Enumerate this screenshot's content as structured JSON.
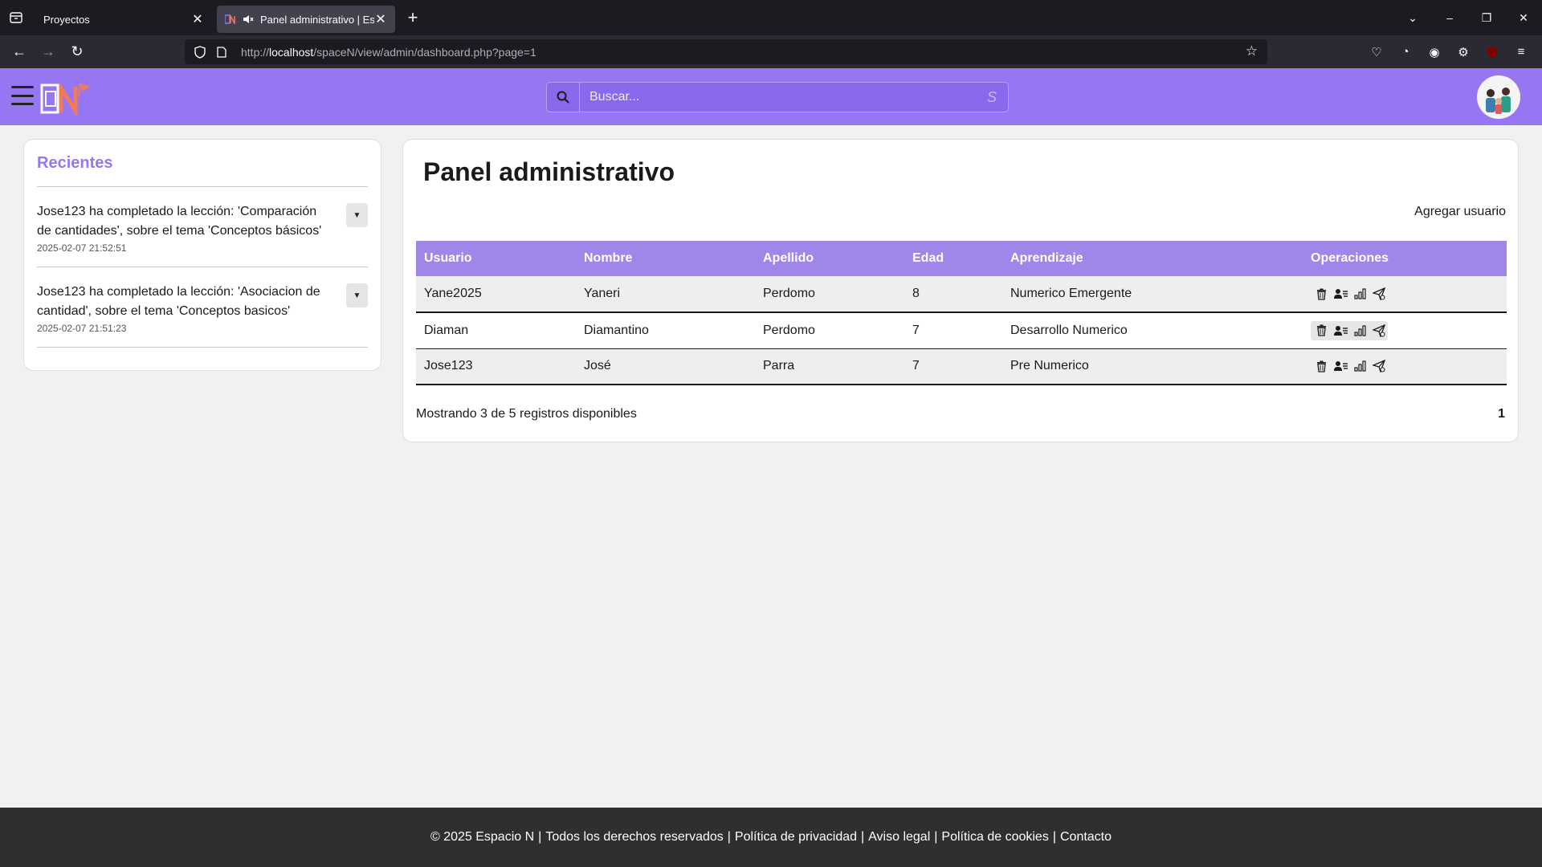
{
  "browser": {
    "tabs": [
      {
        "title": "Proyectos",
        "active": false
      },
      {
        "title": "Panel administrativo | Espacio N",
        "active": true
      }
    ],
    "url_prefix": "http://",
    "url_host": "localhost",
    "url_path": "/spaceN/view/admin/dashboard.php?page=1"
  },
  "header": {
    "search_placeholder": "Buscar...",
    "brand_color": "#9676f2"
  },
  "recent": {
    "title": "Recientes",
    "items": [
      {
        "text": "Jose123 ha completado la lección: 'Comparación de cantidades', sobre el tema 'Conceptos básicos'",
        "time": "2025-02-07 21:52:51"
      },
      {
        "text": "Jose123 ha completado la lección: 'Asociacion de cantidad', sobre el tema 'Conceptos basicos'",
        "time": "2025-02-07 21:51:23"
      }
    ]
  },
  "main": {
    "title": "Panel administrativo",
    "add_user": "Agregar usuario",
    "columns": [
      "Usuario",
      "Nombre",
      "Apellido",
      "Edad",
      "Aprendizaje",
      "Operaciones"
    ],
    "rows": [
      {
        "usuario": "Yane2025",
        "nombre": "Yaneri",
        "apellido": "Perdomo",
        "edad": "8",
        "aprendizaje": "Numerico Emergente"
      },
      {
        "usuario": "Diaman",
        "nombre": "Diamantino",
        "apellido": "Perdomo",
        "edad": "7",
        "aprendizaje": "Desarrollo Numerico"
      },
      {
        "usuario": "Jose123",
        "nombre": "José",
        "apellido": "Parra",
        "edad": "7",
        "aprendizaje": "Pre Numerico"
      }
    ],
    "operation_icons": [
      "trash-icon",
      "user-card-icon",
      "bar-chart-icon",
      "send-icon"
    ],
    "summary": "Mostrando 3 de 5 registros disponibles",
    "page": "1"
  },
  "footer": {
    "copyright": "© 2025 Espacio N",
    "rights": "Todos los derechos reservados",
    "privacy": "Política de privacidad",
    "legal": "Aviso legal",
    "cookies": "Política de cookies",
    "contact": "Contacto"
  }
}
